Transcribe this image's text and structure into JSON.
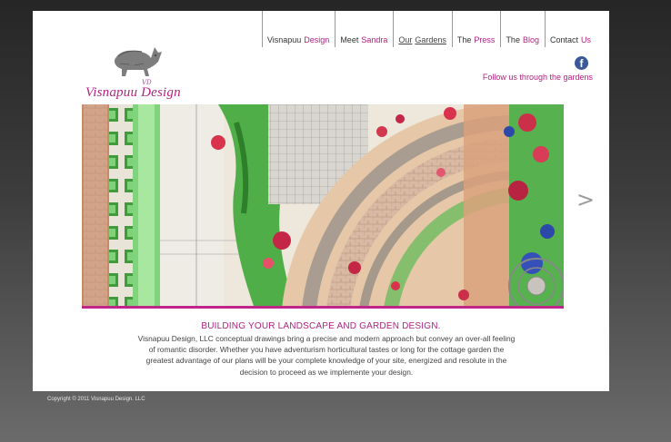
{
  "brand": {
    "monogram": "VD",
    "name": "Visnapuu Design"
  },
  "nav": [
    {
      "part1": "Visnapuu",
      "part2": "Design",
      "active": false
    },
    {
      "part1": "Meet",
      "part2": "Sandra",
      "active": false
    },
    {
      "part1": "Our",
      "part2": "Gardens",
      "active": true
    },
    {
      "part1": "The",
      "part2": "Press",
      "active": false
    },
    {
      "part1": "The",
      "part2": "Blog",
      "active": false
    },
    {
      "part1": "Contact",
      "part2": "Us",
      "active": false
    }
  ],
  "social": {
    "facebook_glyph": "f",
    "follow_text": "Follow us through the gardens"
  },
  "slideshow": {
    "next_glyph": ">"
  },
  "content": {
    "headline": "BUILDING YOUR LANDSCAPE AND GARDEN DESIGN.",
    "lines": [
      "Visnapuu Design, LLC conceptual drawings bring a precise and modern approach but convey an over-all feeling",
      "of romantic disorder. Whether you have adventurism horticultural tastes or long for the cottage garden the",
      "greatest advantage of our plans will be your complete knowledge of your site, energized and resolute in the",
      "decision to proceed as we implemente your design."
    ]
  },
  "footer": {
    "copyright": "Copyright © 2011 Visnapuu Design. LLC"
  },
  "colors": {
    "accent": "#b1237f",
    "facebook": "#3b5998"
  }
}
